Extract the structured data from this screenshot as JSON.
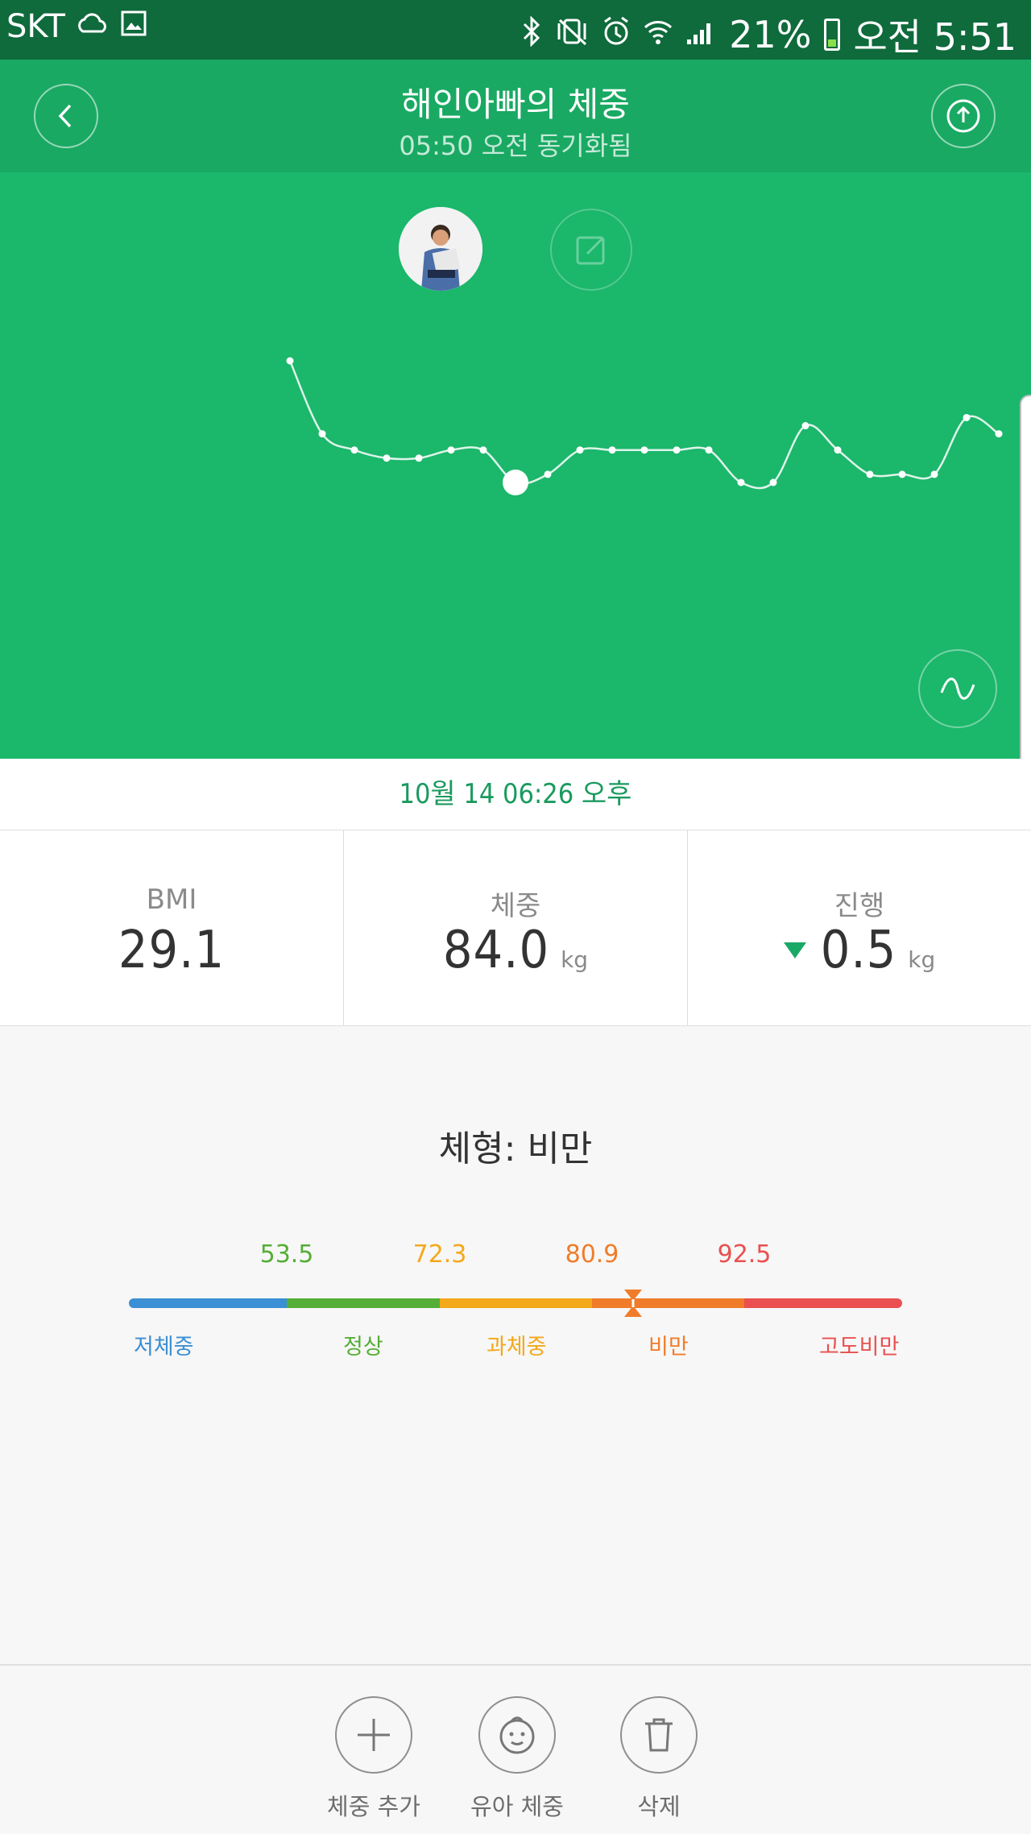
{
  "status_bar": {
    "carrier": "SKT",
    "battery": "21%",
    "time": "오전 5:51",
    "battery_level": 0.21,
    "icons": [
      "cloud-sync-icon",
      "gallery-icon",
      "bluetooth-icon",
      "vibrate-icon",
      "alarm-icon",
      "wifi-icon",
      "signal-icon",
      "battery-icon"
    ]
  },
  "header": {
    "title": "해인아빠의 체중",
    "subtitle": "05:50 오전 동기화됨",
    "back_icon": "chevron-left-icon",
    "upload_icon": "upload-icon"
  },
  "chart_data": {
    "type": "line",
    "title": "",
    "xlabel": "",
    "ylabel": "",
    "y_direction": "higher_weight_up",
    "values": [
      85.5,
      84.6,
      84.4,
      84.3,
      84.3,
      84.4,
      84.4,
      84.0,
      84.1,
      84.4,
      84.4,
      84.4,
      84.4,
      84.4,
      84.0,
      84.0,
      84.7,
      84.4,
      84.1,
      84.1,
      84.1,
      84.8,
      84.6
    ],
    "selected_index": 7,
    "selected_label": "10월 14 06:26 오후"
  },
  "selected_date": "10월 14 06:26 오후",
  "stats": {
    "bmi": {
      "label": "BMI",
      "value": "29.1"
    },
    "weight": {
      "label": "체중",
      "value": "84.0",
      "unit": "kg"
    },
    "progress": {
      "label": "진행",
      "value": "0.5",
      "unit": "kg",
      "direction": "down"
    }
  },
  "body_type": "체형: 비만",
  "scale": {
    "thresholds": [
      "53.5",
      "72.3",
      "80.9",
      "92.5"
    ],
    "categories": [
      "저체중",
      "정상",
      "과체중",
      "비만",
      "고도비만"
    ],
    "colors": [
      "#3b8fd4",
      "#55ae35",
      "#f4a81b",
      "#f07c2a",
      "#e9504f"
    ],
    "threshold_colors": [
      "#55ae35",
      "#f4a81b",
      "#f07c2a",
      "#e9504f"
    ],
    "marker_value": 84.0
  },
  "actions": [
    {
      "label": "체중 추가",
      "icon": "plus-icon"
    },
    {
      "label": "유아 체중",
      "icon": "baby-face-icon"
    },
    {
      "label": "삭제",
      "icon": "trash-icon"
    }
  ]
}
